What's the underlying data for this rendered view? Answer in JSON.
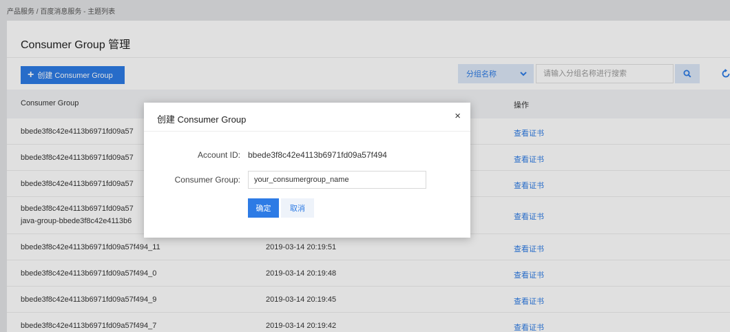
{
  "breadcrumb": "产品服务 / 百度消息服务 - 主题列表",
  "page": {
    "title": "Consumer Group 管理"
  },
  "toolbar": {
    "create_label": "创建 Consumer Group",
    "select_value": "分组名称",
    "search_placeholder": "请输入分组名称进行搜索"
  },
  "table": {
    "headers": [
      "Consumer Group",
      "",
      "操作"
    ],
    "rows": [
      {
        "group": "bbede3f8c42e4113b6971fd09a57",
        "group2": "",
        "time": "",
        "action": "查看证书"
      },
      {
        "group": "bbede3f8c42e4113b6971fd09a57",
        "group2": "",
        "time": "",
        "action": "查看证书"
      },
      {
        "group": "bbede3f8c42e4113b6971fd09a57",
        "group2": "",
        "time": "",
        "action": "查看证书"
      },
      {
        "group": "bbede3f8c42e4113b6971fd09a57",
        "group2": "java-group-bbede3f8c42e4113b6",
        "time": "",
        "action": "查看证书"
      },
      {
        "group": "bbede3f8c42e4113b6971fd09a57f494_11",
        "group2": "",
        "time": "2019-03-14 20:19:51",
        "action": "查看证书"
      },
      {
        "group": "bbede3f8c42e4113b6971fd09a57f494_0",
        "group2": "",
        "time": "2019-03-14 20:19:48",
        "action": "查看证书"
      },
      {
        "group": "bbede3f8c42e4113b6971fd09a57f494_9",
        "group2": "",
        "time": "2019-03-14 20:19:45",
        "action": "查看证书"
      },
      {
        "group": "bbede3f8c42e4113b6971fd09a57f494_7",
        "group2": "",
        "time": "2019-03-14 20:19:42",
        "action": "查看证书"
      }
    ]
  },
  "modal": {
    "title": "创建 Consumer Group",
    "close": "×",
    "account_label": "Account ID:",
    "account_value": "bbede3f8c42e4113b6971fd09a57f494",
    "group_label": "Consumer Group:",
    "group_value": "your_consumergroup_name",
    "ok_label": "确定",
    "cancel_label": "取消"
  },
  "colors": {
    "primary": "#2d7be5",
    "light_blue": "#dce8f7",
    "background": "#e3e4e6"
  },
  "icons": [
    "plus-icon",
    "chevron-down-icon",
    "search-icon",
    "refresh-icon",
    "close-icon"
  ]
}
